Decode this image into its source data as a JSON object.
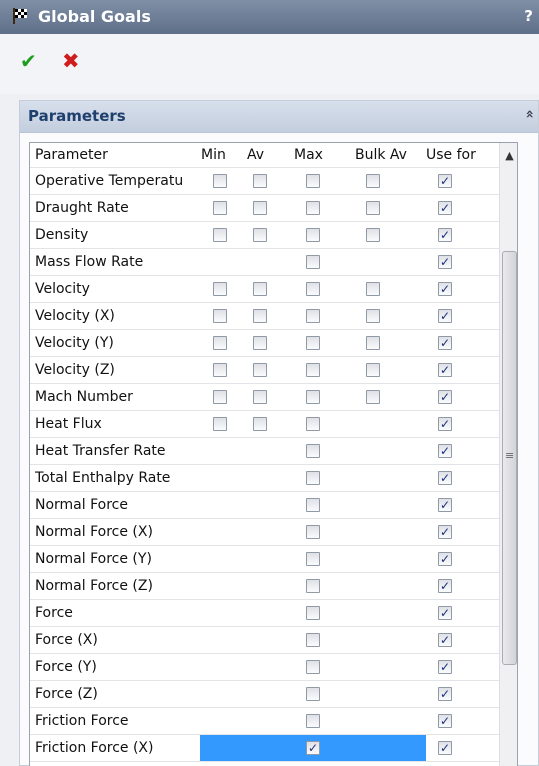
{
  "window": {
    "title": "Global Goals",
    "help": "?"
  },
  "toolbar": {
    "ok_glyph": "✔",
    "cancel_glyph": "✖"
  },
  "panel": {
    "title": "Parameters",
    "collapse_glyph": "«"
  },
  "columns": [
    "Parameter",
    "Min",
    "Av",
    "Max",
    "Bulk Av",
    "Use for"
  ],
  "rows": [
    {
      "name": "Operative Temperatu",
      "min": false,
      "av": false,
      "max": false,
      "bulk": false,
      "use": true
    },
    {
      "name": "Draught Rate",
      "min": false,
      "av": false,
      "max": false,
      "bulk": false,
      "use": true
    },
    {
      "name": "Density",
      "min": false,
      "av": false,
      "max": false,
      "bulk": false,
      "use": true
    },
    {
      "name": "Mass Flow Rate",
      "min": null,
      "av": null,
      "max": false,
      "bulk": null,
      "use": true
    },
    {
      "name": "Velocity",
      "min": false,
      "av": false,
      "max": false,
      "bulk": false,
      "use": true
    },
    {
      "name": "Velocity (X)",
      "min": false,
      "av": false,
      "max": false,
      "bulk": false,
      "use": true
    },
    {
      "name": "Velocity (Y)",
      "min": false,
      "av": false,
      "max": false,
      "bulk": false,
      "use": true
    },
    {
      "name": "Velocity (Z)",
      "min": false,
      "av": false,
      "max": false,
      "bulk": false,
      "use": true
    },
    {
      "name": "Mach Number",
      "min": false,
      "av": false,
      "max": false,
      "bulk": false,
      "use": true
    },
    {
      "name": "Heat Flux",
      "min": false,
      "av": false,
      "max": false,
      "bulk": null,
      "use": true
    },
    {
      "name": "Heat Transfer Rate",
      "min": null,
      "av": null,
      "max": false,
      "bulk": null,
      "use": true
    },
    {
      "name": "Total Enthalpy Rate",
      "min": null,
      "av": null,
      "max": false,
      "bulk": null,
      "use": true
    },
    {
      "name": "Normal Force",
      "min": null,
      "av": null,
      "max": false,
      "bulk": null,
      "use": true
    },
    {
      "name": "Normal Force (X)",
      "min": null,
      "av": null,
      "max": false,
      "bulk": null,
      "use": true
    },
    {
      "name": "Normal Force (Y)",
      "min": null,
      "av": null,
      "max": false,
      "bulk": null,
      "use": true
    },
    {
      "name": "Normal Force (Z)",
      "min": null,
      "av": null,
      "max": false,
      "bulk": null,
      "use": true
    },
    {
      "name": "Force",
      "min": null,
      "av": null,
      "max": false,
      "bulk": null,
      "use": true
    },
    {
      "name": "Force (X)",
      "min": null,
      "av": null,
      "max": false,
      "bulk": null,
      "use": true
    },
    {
      "name": "Force (Y)",
      "min": null,
      "av": null,
      "max": false,
      "bulk": null,
      "use": true
    },
    {
      "name": "Force (Z)",
      "min": null,
      "av": null,
      "max": false,
      "bulk": null,
      "use": true
    },
    {
      "name": "Friction Force",
      "min": null,
      "av": null,
      "max": false,
      "bulk": null,
      "use": true
    },
    {
      "name": "Friction Force (X)",
      "min": null,
      "av": null,
      "max": true,
      "bulk": null,
      "use": true,
      "selected": true
    }
  ],
  "scrollbar": {
    "up_glyph": "▲",
    "grip_glyph": "≡"
  },
  "colors": {
    "titlebar": "#6d7d94",
    "selection": "#3399ff",
    "ok": "#1e9e1e",
    "cancel": "#d01c1c"
  }
}
